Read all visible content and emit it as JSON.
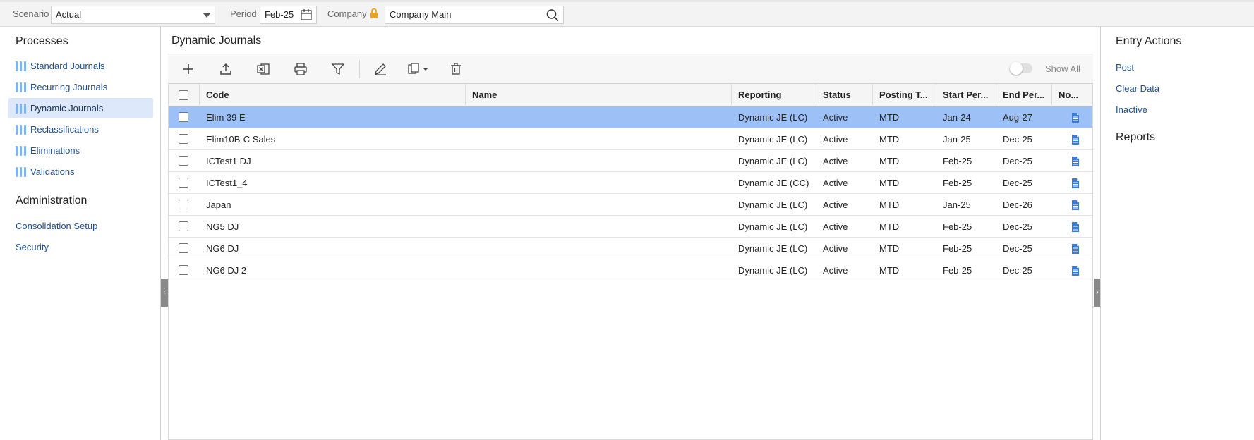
{
  "filters": {
    "scenario_label": "Scenario",
    "scenario_value": "Actual",
    "period_label": "Period",
    "period_value": "Feb-25",
    "company_label": "Company",
    "company_value": "Company Main"
  },
  "leftnav": {
    "processes_heading": "Processes",
    "processes": [
      {
        "label": "Standard Journals"
      },
      {
        "label": "Recurring Journals"
      },
      {
        "label": "Dynamic Journals",
        "active": true
      },
      {
        "label": "Reclassifications"
      },
      {
        "label": "Eliminations"
      },
      {
        "label": "Validations"
      }
    ],
    "admin_heading": "Administration",
    "admin": [
      {
        "label": "Consolidation Setup"
      },
      {
        "label": "Security"
      }
    ]
  },
  "main": {
    "title": "Dynamic Journals",
    "show_all_label": "Show All",
    "columns": [
      "Code",
      "Name",
      "Reporting",
      "Status",
      "Posting T...",
      "Start Per...",
      "End Per...",
      "No..."
    ],
    "rows": [
      {
        "code": "Elim 39 E",
        "name": "",
        "reporting": "Dynamic JE (LC)",
        "status": "Active",
        "posting": "MTD",
        "start": "Jan-24",
        "end": "Aug-27",
        "selected": true
      },
      {
        "code": "Elim10B-C Sales",
        "name": "",
        "reporting": "Dynamic JE (LC)",
        "status": "Active",
        "posting": "MTD",
        "start": "Jan-25",
        "end": "Dec-25"
      },
      {
        "code": "ICTest1 DJ",
        "name": "",
        "reporting": "Dynamic JE (LC)",
        "status": "Active",
        "posting": "MTD",
        "start": "Feb-25",
        "end": "Dec-25"
      },
      {
        "code": "ICTest1_4",
        "name": "",
        "reporting": "Dynamic JE (CC)",
        "status": "Active",
        "posting": "MTD",
        "start": "Feb-25",
        "end": "Dec-25"
      },
      {
        "code": "Japan",
        "name": "",
        "reporting": "Dynamic JE (LC)",
        "status": "Active",
        "posting": "MTD",
        "start": "Jan-25",
        "end": "Dec-26"
      },
      {
        "code": "NG5 DJ",
        "name": "",
        "reporting": "Dynamic JE (LC)",
        "status": "Active",
        "posting": "MTD",
        "start": "Feb-25",
        "end": "Dec-25"
      },
      {
        "code": "NG6 DJ",
        "name": "",
        "reporting": "Dynamic JE (LC)",
        "status": "Active",
        "posting": "MTD",
        "start": "Feb-25",
        "end": "Dec-25"
      },
      {
        "code": "NG6 DJ 2",
        "name": "",
        "reporting": "Dynamic JE (LC)",
        "status": "Active",
        "posting": "MTD",
        "start": "Feb-25",
        "end": "Dec-25"
      }
    ]
  },
  "rightpanel": {
    "entry_heading": "Entry Actions",
    "entry_actions": [
      {
        "label": "Post"
      },
      {
        "label": "Clear Data"
      },
      {
        "label": "Inactive"
      }
    ],
    "reports_heading": "Reports"
  },
  "colors": {
    "accent": "#1f4e8c",
    "selected_row": "#9dc0f7",
    "nav_active": "#dde9fb",
    "nav_bar": "#7fb3f2",
    "lock": "#f0a020",
    "note_icon": "#3a7bd5"
  },
  "icons": {
    "toolbar": [
      "add-icon",
      "upload-icon",
      "excel-icon",
      "print-icon",
      "filter-icon",
      "edit-icon",
      "copy-icon",
      "delete-icon"
    ]
  }
}
